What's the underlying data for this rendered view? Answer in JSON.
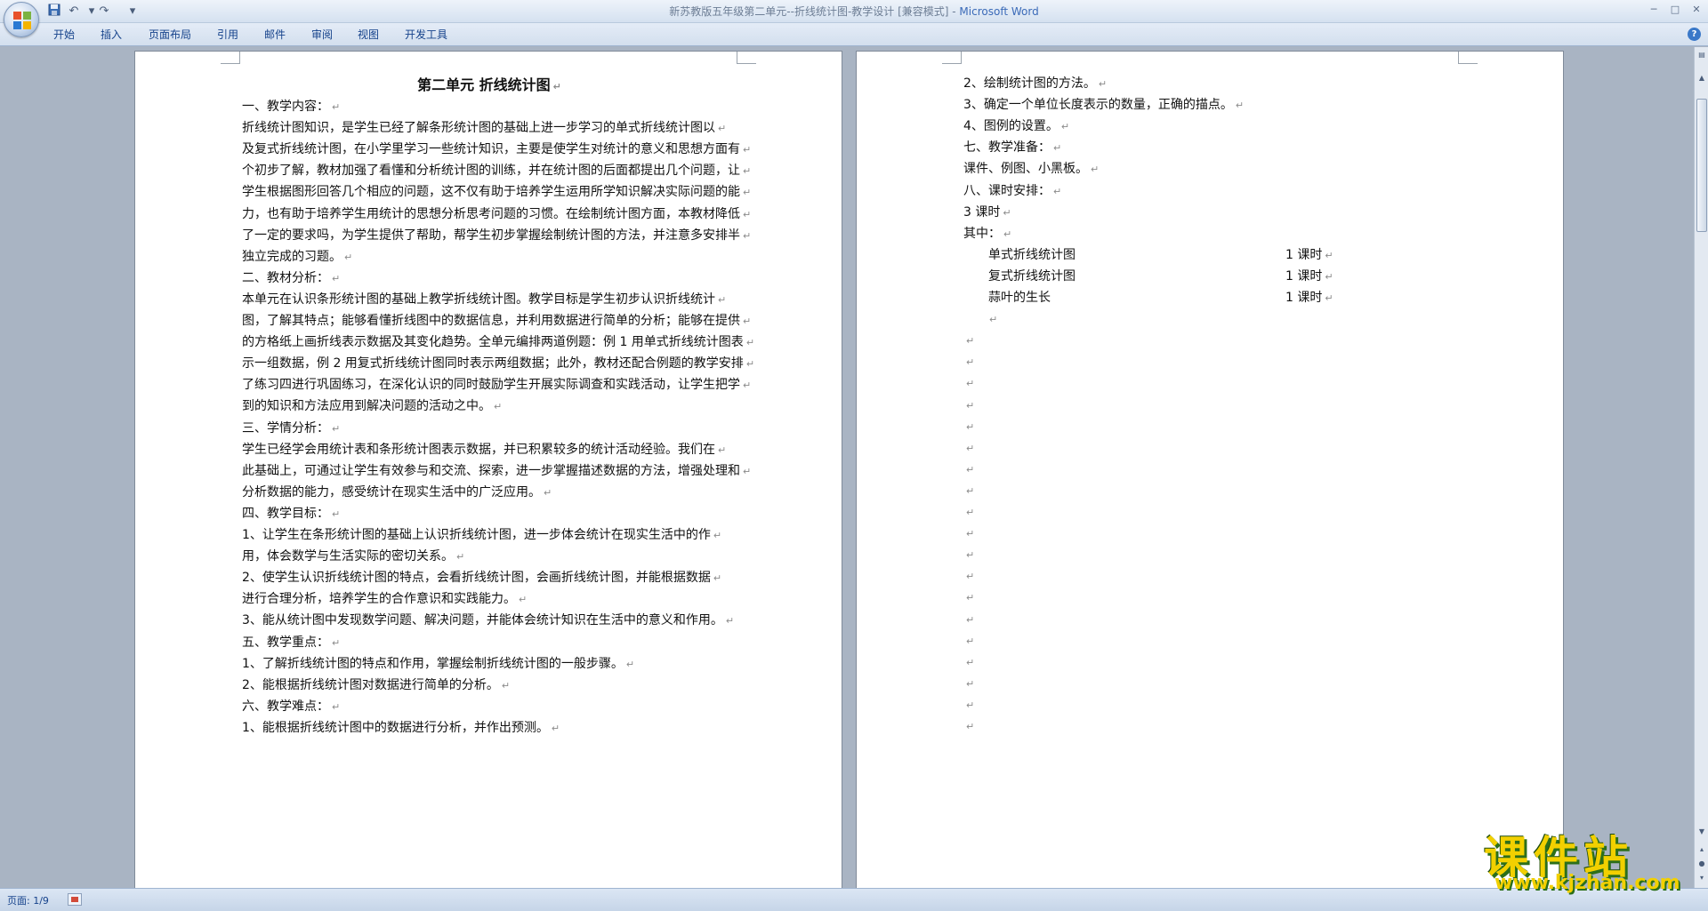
{
  "window": {
    "title": "新苏教版五年级第二单元--折线统计图-教学设计 [兼容模式] - ",
    "app_name": "Microsoft Word"
  },
  "quick_access": {
    "save_icon": "save-icon",
    "undo_icon": "undo-icon",
    "redo_icon": "redo-icon",
    "customize_icon": "dropdown-icon"
  },
  "ribbon": {
    "tabs": [
      "开始",
      "插入",
      "页面布局",
      "引用",
      "邮件",
      "审阅",
      "视图",
      "开发工具"
    ]
  },
  "page1": {
    "title": "第二单元    折线统计图",
    "lines": [
      "一、教学内容：",
      "      折线统计图知识，是学生已经了解条形统计图的基础上进一步学习的单式折线统计图以",
      "及复式折线统计图，在小学里学习一些统计知识，主要是使学生对统计的意义和思想方面有",
      "个初步了解，教材加强了看懂和分析统计图的训练，并在统计图的后面都提出几个问题，让",
      "学生根据图形回答几个相应的问题，这不仅有助于培养学生运用所学知识解决实际问题的能",
      "力，也有助于培养学生用统计的思想分析思考问题的习惯。在绘制统计图方面，本教材降低",
      "了一定的要求吗，为学生提供了帮助，帮学生初步掌握绘制统计图的方法，并注意多安排半",
      "独立完成的习题。",
      "二、教材分析：",
      "      本单元在认识条形统计图的基础上教学折线统计图。教学目标是学生初步认识折线统计",
      "图，了解其特点；能够看懂折线图中的数据信息，并利用数据进行简单的分析；能够在提供",
      "的方格纸上画折线表示数据及其变化趋势。全单元编排两道例题：例 1 用单式折线统计图表",
      "示一组数据，例 2 用复式折线统计图同时表示两组数据；此外，教材还配合例题的教学安排",
      "了练习四进行巩固练习，在深化认识的同时鼓励学生开展实际调查和实践活动，让学生把学",
      "到的知识和方法应用到解决问题的活动之中。",
      "三、学情分析：",
      "      学生已经学会用统计表和条形统计图表示数据，并已积累较多的统计活动经验。我们在",
      "此基础上，可通过让学生有效参与和交流、探索，进一步掌握描述数据的方法，增强处理和",
      "分析数据的能力，感受统计在现实生活中的广泛应用。",
      "四、教学目标：",
      "      1、让学生在条形统计图的基础上认识折线统计图，进一步体会统计在现实生活中的作",
      "用，体会数学与生活实际的密切关系。",
      "      2、使学生认识折线统计图的特点，会看折线统计图，会画折线统计图，并能根据数据",
      "进行合理分析，培养学生的合作意识和实践能力。",
      "      3、能从统计图中发现数学问题、解决问题，并能体会统计知识在生活中的意义和作用。",
      "五、教学重点：",
      "      1、了解折线统计图的特点和作用，掌握绘制折线统计图的一般步骤。",
      "      2、能根据折线统计图对数据进行简单的分析。",
      "六、教学难点：",
      "      1、能根据折线统计图中的数据进行分析，并作出预测。"
    ],
    "para_mark": "↵"
  },
  "page2": {
    "lines": [
      "      2、绘制统计图的方法。",
      "      3、确定一个单位长度表示的数量，正确的描点。",
      "      4、图例的设置。",
      "七、教学准备：",
      "      课件、例图、小黑板。",
      "八、课时安排：",
      "      3 课时",
      "       其中："
    ],
    "schedule": [
      {
        "name": "单式折线统计图",
        "hours": "1 课时"
      },
      {
        "name": "复式折线统计图",
        "hours": "1 课时"
      },
      {
        "name": "蒜叶的生长",
        "hours": "1 课时"
      }
    ]
  },
  "status_bar": {
    "page_info": "页面: 1/9"
  },
  "watermark": {
    "text": "课件站",
    "url": "www.kjzhan.com"
  }
}
